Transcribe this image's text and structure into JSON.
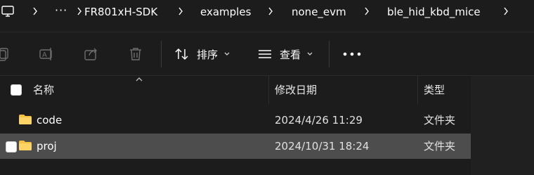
{
  "address_bar": {
    "ellipsis": "···",
    "crumbs": [
      "FR801xH-SDK",
      "examples",
      "none_evm",
      "ble_hid_kbd_mice"
    ]
  },
  "command_bar": {
    "sort_label": "排序",
    "view_label": "查看"
  },
  "list": {
    "columns": {
      "name": "名称",
      "date": "修改日期",
      "type": "类型"
    },
    "rows": [
      {
        "name": "code",
        "date": "2024/4/26 11:29",
        "type": "文件夹",
        "selected": false
      },
      {
        "name": "proj",
        "date": "2024/10/31 18:24",
        "type": "文件夹",
        "selected": true
      }
    ]
  },
  "colors": {
    "background": "#1c1c1c",
    "selected_row": "#4d4d4d",
    "folder": "#f6c244",
    "icon_disabled": "#6e6e6e"
  }
}
